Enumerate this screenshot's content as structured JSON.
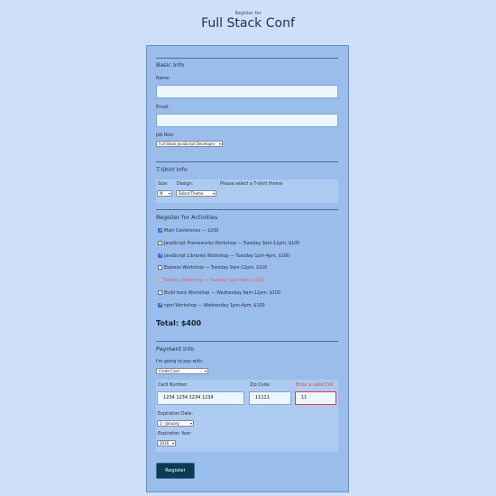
{
  "header": {
    "subtitle": "Register for",
    "title": "Full Stack Conf"
  },
  "basic_info": {
    "title": "Basic Info",
    "name_label": "Name:",
    "email_label": "Email:",
    "job_role_label": "Job Role",
    "job_role_value": "Full Stack JavaScript Developer"
  },
  "tshirt": {
    "title": "T-Shirt Info",
    "size_label": "Size:",
    "size_value": "M",
    "design_label": "Design:",
    "design_value": "Select Theme",
    "theme_hint": "Please select a T-shirt theme"
  },
  "activities": {
    "title": "Register for Activities",
    "items": [
      {
        "label": "Main Conference — $200",
        "checked": true,
        "disabled": false
      },
      {
        "label": "JavaScript Frameworks Workshop — Tuesday 9am-12pm, $100",
        "checked": false,
        "disabled": false
      },
      {
        "label": "JavaScript Libraries Workshop — Tuesday 1pm-4pm, $100",
        "checked": true,
        "disabled": false
      },
      {
        "label": "Express Workshop — Tuesday 9am-12pm, $100",
        "checked": false,
        "disabled": false
      },
      {
        "label": "Node.js Workshop — Tuesday 1pm-4pm, $100",
        "checked": false,
        "disabled": true
      },
      {
        "label": "Build tools Workshop — Wednesday 9am-12pm, $100",
        "checked": false,
        "disabled": false
      },
      {
        "label": "npm Workshop — Wednesday 1pm-4pm, $100",
        "checked": true,
        "disabled": false
      }
    ],
    "total": "Total: $400"
  },
  "payment": {
    "title": "Payment Info",
    "pay_label": "I'm going to pay with:",
    "pay_value": "Credit Card",
    "card_number_label": "Card Number:",
    "card_number_value": "1234 1234 1234 1234",
    "zip_label": "Zip Code:",
    "zip_value": "11111",
    "cvv_label": "Enter a valid CVV",
    "cvv_value": "11",
    "exp_date_label": "Expiration Date:",
    "exp_date_value": "1 - January",
    "exp_year_label": "Expiration Year:",
    "exp_year_value": "2016"
  },
  "submit_label": "Register",
  "colors": {
    "page_bg": "#cddff9",
    "form_bg": "#9abdec",
    "panel_bg": "#adcbf0",
    "submit_bg": "#0e3a55",
    "error": "#e03a4a"
  }
}
